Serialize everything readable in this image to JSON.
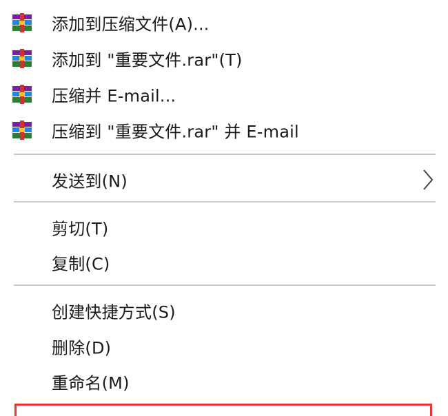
{
  "context_menu": {
    "items": [
      {
        "label": "添加到压缩文件(A)...",
        "icon": "winrar-archive-icon"
      },
      {
        "label": "添加到 \"重要文件.rar\"(T)",
        "icon": "winrar-archive-icon"
      },
      {
        "label": "压缩并 E-mail...",
        "icon": "winrar-archive-icon"
      },
      {
        "label": "压缩到 \"重要文件.rar\" 并 E-mail",
        "icon": "winrar-archive-icon"
      },
      {
        "label": "发送到(N)",
        "icon": "chevron-right-icon"
      },
      {
        "label": "剪切(T)"
      },
      {
        "label": "复制(C)"
      },
      {
        "label": "创建快捷方式(S)"
      },
      {
        "label": "删除(D)"
      },
      {
        "label": "重命名(M)"
      }
    ],
    "highlight_color": "#e53935",
    "separator_color": "#c9c9c9"
  }
}
